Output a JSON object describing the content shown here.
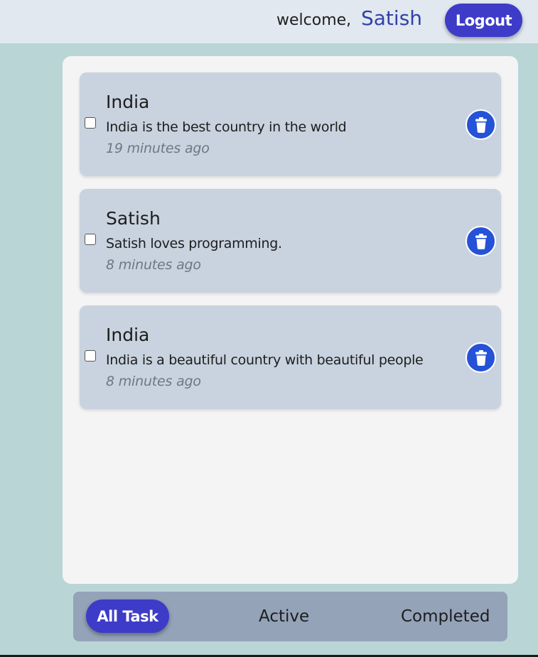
{
  "header": {
    "welcome": "welcome,",
    "username": "Satish",
    "logout_label": "Logout"
  },
  "tasks": [
    {
      "title": "India",
      "description": "India is the best country in the world",
      "time": "19 minutes ago",
      "completed": false
    },
    {
      "title": "Satish",
      "description": "Satish loves programming.",
      "time": "8 minutes ago",
      "completed": false
    },
    {
      "title": "India",
      "description": "India is a beautiful country with beautiful people",
      "time": "8 minutes ago",
      "completed": false
    }
  ],
  "filters": {
    "all": "All Task",
    "active": "Active",
    "completed": "Completed",
    "selected": "all"
  },
  "icons": {
    "delete": "trash-icon"
  },
  "colors": {
    "accent": "#3d3bc8",
    "delete": "#2552d6",
    "username": "#3142a8",
    "card": "#c9d3df",
    "background": "#b9d5d6"
  }
}
